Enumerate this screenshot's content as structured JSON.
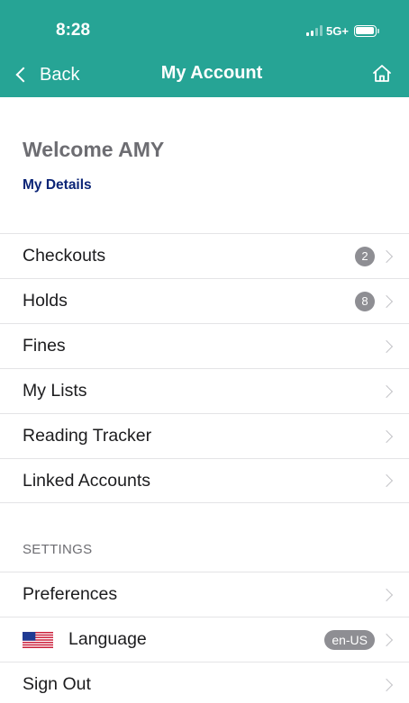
{
  "status_bar": {
    "time": "8:28",
    "network": "5G+"
  },
  "nav": {
    "back_label": "Back",
    "title": "My Account"
  },
  "welcome": {
    "text": "Welcome AMY",
    "details_link": "My Details"
  },
  "account_items": [
    {
      "label": "Checkouts",
      "badge": "2"
    },
    {
      "label": "Holds",
      "badge": "8"
    },
    {
      "label": "Fines"
    },
    {
      "label": "My Lists"
    },
    {
      "label": "Reading Tracker"
    },
    {
      "label": "Linked Accounts"
    }
  ],
  "settings": {
    "header": "SETTINGS",
    "items": [
      {
        "label": "Preferences"
      },
      {
        "label": "Language",
        "value": "en-US",
        "icon": "us-flag-icon"
      },
      {
        "label": "Sign Out"
      }
    ]
  },
  "colors": {
    "header_bg": "#26a495",
    "link": "#0c2577",
    "badge": "#8e8e93"
  }
}
